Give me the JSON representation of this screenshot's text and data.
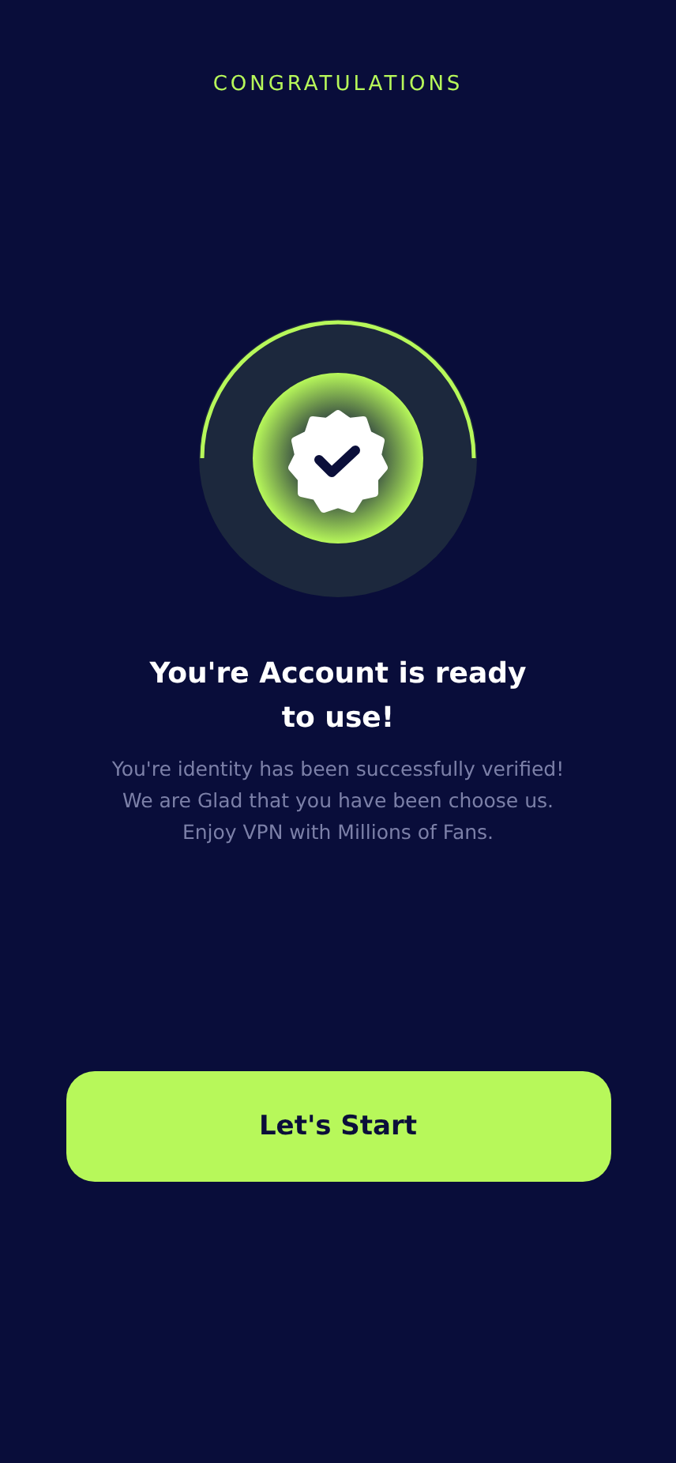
{
  "header": {
    "title": "CONGRATULATIONS"
  },
  "status": {
    "title": "You're Account is ready to use!",
    "lines": [
      "You're identity has been successfully verified!",
      "We are Glad that you have been choose us.",
      "Enjoy VPN with Millions of Fans."
    ]
  },
  "button": {
    "label": "Let's Start"
  }
}
